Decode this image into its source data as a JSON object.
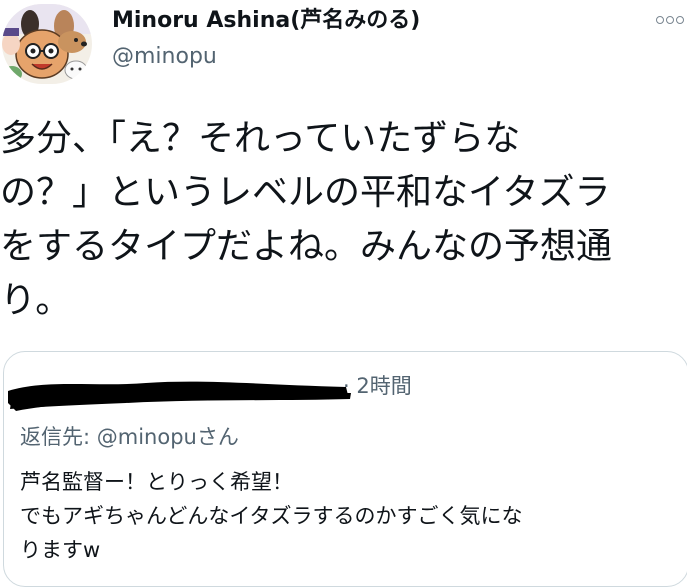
{
  "author": {
    "display_name": "Minoru Ashina(芦名みのる)",
    "handle": "@minopu"
  },
  "tweet": {
    "lines": [
      "多分、「え？それっていたずらな",
      "の？」というレベルの平和なイタズラ",
      "をするタイプだよね。みんなの予想通",
      "り。"
    ]
  },
  "quoted": {
    "time": "· 2時間",
    "reply_prefix": "返信先: ",
    "reply_mention": "@minopu",
    "reply_suffix": "さん",
    "lines": [
      "芦名監督ー！とりっく希望！",
      "でもアギちゃんどんなイタズラするのかすごく気にな",
      "りますw"
    ]
  },
  "icons": {
    "avatar": "cartoon-avatar-icon",
    "more": "more-options-icon"
  },
  "colors": {
    "text": "#0f1419",
    "secondary": "#536471",
    "border": "#cfd9de",
    "redaction": "#000000"
  }
}
